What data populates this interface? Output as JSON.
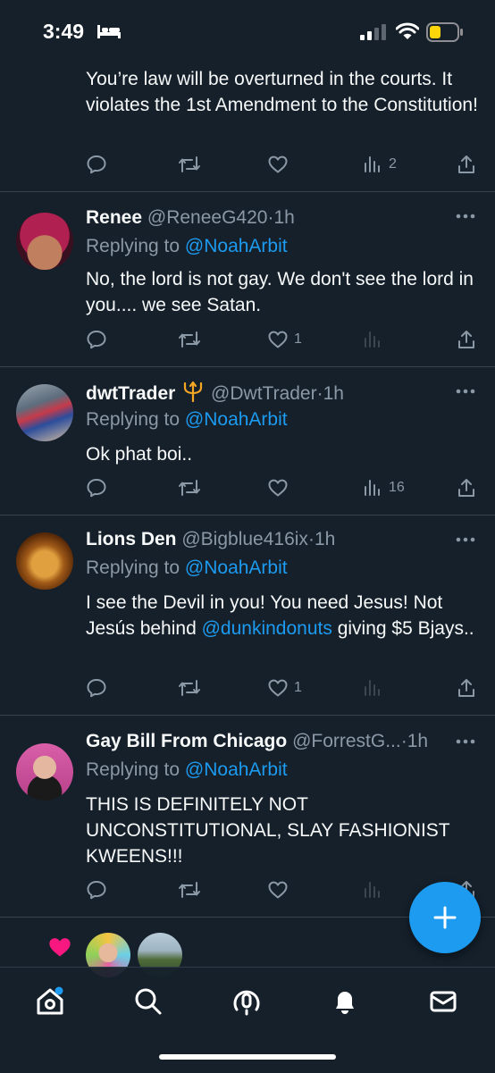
{
  "status_bar": {
    "time": "3:49"
  },
  "tweets": [
    {
      "text": "You’re law will be overturned in the courts. It violates the 1st Amendment to the Constitution!",
      "likes": "",
      "views": "2"
    },
    {
      "name": "Renee",
      "handle": "@ReneeG420",
      "time": "1h",
      "replying_label": "Replying to",
      "replying_to": "@NoahArbit",
      "text": "No, the lord is not gay. We don't see the lord in you.... we see Satan.",
      "likes": "1",
      "views": ""
    },
    {
      "name": "dwtTrader",
      "handle": "@DwtTrader",
      "time": "1h",
      "replying_label": "Replying to",
      "replying_to": "@NoahArbit",
      "text": "Ok phat boi..",
      "likes": "",
      "views": "16"
    },
    {
      "name": "Lions Den",
      "handle": "@Bigblue416ix",
      "time": "1h",
      "replying_label": "Replying to",
      "replying_to": "@NoahArbit",
      "text_before": "I see the Devil in you! You need Jesus! Not Jesús behind ",
      "text_mention": "@dunkindonuts",
      "text_after": " giving $5 Bjays..",
      "likes": "1",
      "views": ""
    },
    {
      "name": "Gay Bill From Chicago",
      "handle": "@ForrestG...",
      "time": "1h",
      "replying_label": "Replying to",
      "replying_to": "@NoahArbit",
      "text": "THIS IS DEFINITELY NOT UNCONSTITUTIONAL, SLAY FASHIONIST KWEENS!!!",
      "likes": "",
      "views": ""
    }
  ],
  "separator": "·",
  "icons": {
    "status": [
      "bed-icon",
      "signal-icon",
      "wifi-icon",
      "battery-icon"
    ],
    "actions": [
      "reply-icon",
      "retweet-icon",
      "like-icon",
      "views-icon",
      "share-icon"
    ],
    "nav": [
      "home-icon",
      "search-icon",
      "spaces-icon",
      "notifications-icon",
      "messages-icon"
    ],
    "fab": "plus-icon"
  },
  "colors": {
    "background": "#15202b",
    "accent": "#1d9bf0",
    "secondary_text": "#8b98a5",
    "primary_text": "#f7f9f9",
    "heart": "#f91880",
    "battery": "#ffd60a"
  }
}
